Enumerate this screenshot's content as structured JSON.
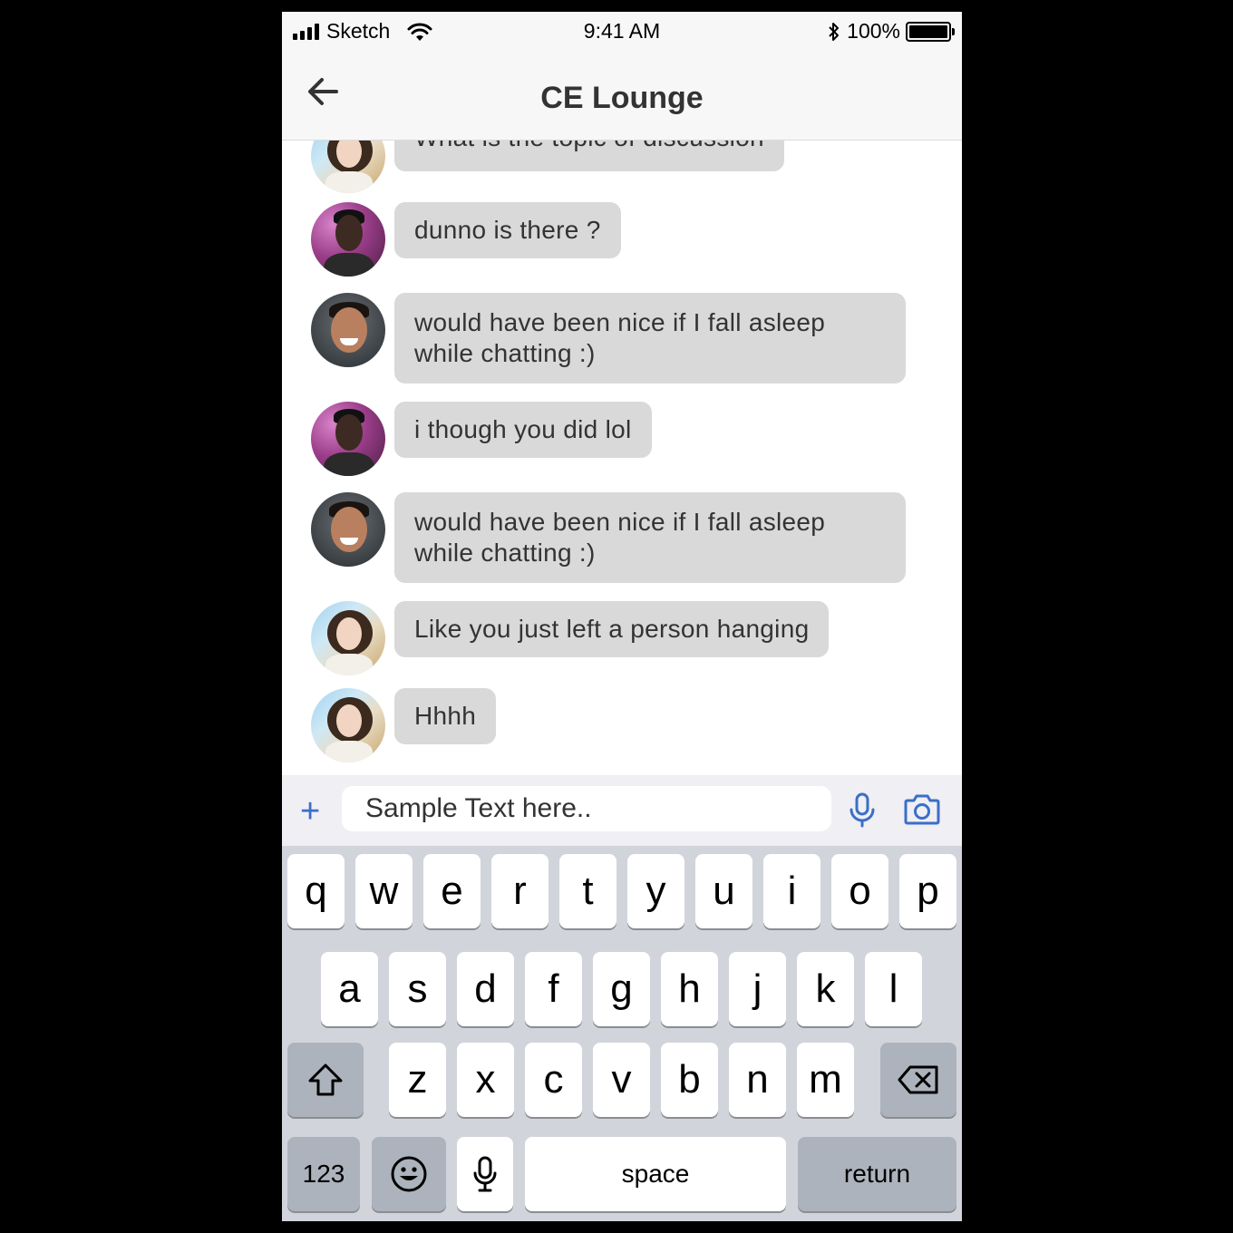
{
  "status_bar": {
    "carrier": "Sketch",
    "time": "9:41 AM",
    "battery": "100%"
  },
  "nav": {
    "title": "CE Lounge"
  },
  "messages": [
    {
      "avatar": "woman",
      "text": "What is the topic of discussion"
    },
    {
      "avatar": "man-curly",
      "text": "dunno is there ?"
    },
    {
      "avatar": "man-smiling",
      "text": "would have been nice if I fall asleep while chatting :)"
    },
    {
      "avatar": "man-curly",
      "text": "i though you did lol"
    },
    {
      "avatar": "man-smiling",
      "text": "would have been nice if I fall asleep while chatting :)"
    },
    {
      "avatar": "woman",
      "text": "Like you just left a person hanging"
    },
    {
      "avatar": "woman",
      "text": "Hhhh"
    }
  ],
  "composer": {
    "placeholder": "Sample Text here..",
    "plus": "+",
    "accent_color": "#3b6fc7"
  },
  "keyboard": {
    "row1": [
      "q",
      "w",
      "e",
      "r",
      "t",
      "y",
      "u",
      "i",
      "o",
      "p"
    ],
    "row2": [
      "a",
      "s",
      "d",
      "f",
      "g",
      "h",
      "j",
      "k",
      "l"
    ],
    "row3": [
      "z",
      "x",
      "c",
      "v",
      "b",
      "n",
      "m"
    ],
    "numbers_label": "123",
    "space_label": "space",
    "return_label": "return",
    "icons": [
      "shift-icon",
      "backspace-icon",
      "emoji-icon",
      "microphone-icon"
    ]
  }
}
